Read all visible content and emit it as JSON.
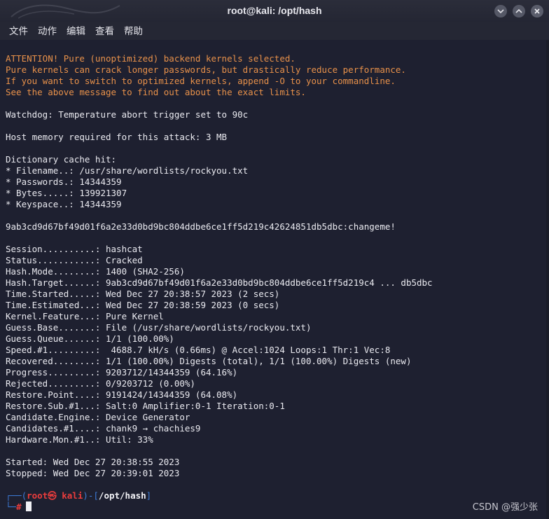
{
  "window": {
    "title": "root@kali: /opt/hash",
    "minimize_glyph": "⌃",
    "maximize_glyph": "⌃",
    "close_glyph": "✕"
  },
  "menu": {
    "items": [
      "文件",
      "动作",
      "编辑",
      "查看",
      "帮助"
    ]
  },
  "terminal": {
    "warning_lines": [
      "ATTENTION! Pure (unoptimized) backend kernels selected.",
      "Pure kernels can crack longer passwords, but drastically reduce performance.",
      "If you want to switch to optimized kernels, append -O to your commandline.",
      "See the above message to find out about the exact limits."
    ],
    "watchdog": "Watchdog: Temperature abort trigger set to 90c",
    "host_memory": "Host memory required for this attack: 3 MB",
    "dict_header": "Dictionary cache hit:",
    "dict_lines": [
      "* Filename..: /usr/share/wordlists/rockyou.txt",
      "* Passwords.: 14344359",
      "* Bytes.....: 139921307",
      "* Keyspace..: 14344359"
    ],
    "cracked_line": "9ab3cd9d67bf49d01f6a2e33d0bd9bc804ddbe6ce1ff5d219c42624851db5dbc:changeme!",
    "status_lines": [
      "Session..........: hashcat",
      "Status...........: Cracked",
      "Hash.Mode........: 1400 (SHA2-256)",
      "Hash.Target......: 9ab3cd9d67bf49d01f6a2e33d0bd9bc804ddbe6ce1ff5d219c4 ... db5dbc",
      "Time.Started.....: Wed Dec 27 20:38:57 2023 (2 secs)",
      "Time.Estimated...: Wed Dec 27 20:38:59 2023 (0 secs)",
      "Kernel.Feature...: Pure Kernel",
      "Guess.Base.......: File (/usr/share/wordlists/rockyou.txt)",
      "Guess.Queue......: 1/1 (100.00%)",
      "Speed.#1.........:  4688.7 kH/s (0.66ms) @ Accel:1024 Loops:1 Thr:1 Vec:8",
      "Recovered........: 1/1 (100.00%) Digests (total), 1/1 (100.00%) Digests (new)",
      "Progress.........: 9203712/14344359 (64.16%)",
      "Rejected.........: 0/9203712 (0.00%)",
      "Restore.Point....: 9191424/14344359 (64.08%)",
      "Restore.Sub.#1...: Salt:0 Amplifier:0-1 Iteration:0-1",
      "Candidate.Engine.: Device Generator",
      "Candidates.#1....: chank9 → chachies9",
      "Hardware.Mon.#1..: Util: 33%"
    ],
    "started": "Started: Wed Dec 27 20:38:55 2023",
    "stopped": "Stopped: Wed Dec 27 20:39:01 2023",
    "prompt": {
      "corner_top": "┌──(",
      "user": "root㉿ kali",
      "mid": ")-[",
      "path": "/opt/hash",
      "end": "]",
      "corner_bottom": "└─",
      "hash": "#"
    }
  },
  "watermark": "CSDN @强少张",
  "colors": {
    "warning": "#e8914a",
    "prompt_blue": "#3d7bd6",
    "prompt_red": "#ea3c3c",
    "background": "#1e2030"
  }
}
